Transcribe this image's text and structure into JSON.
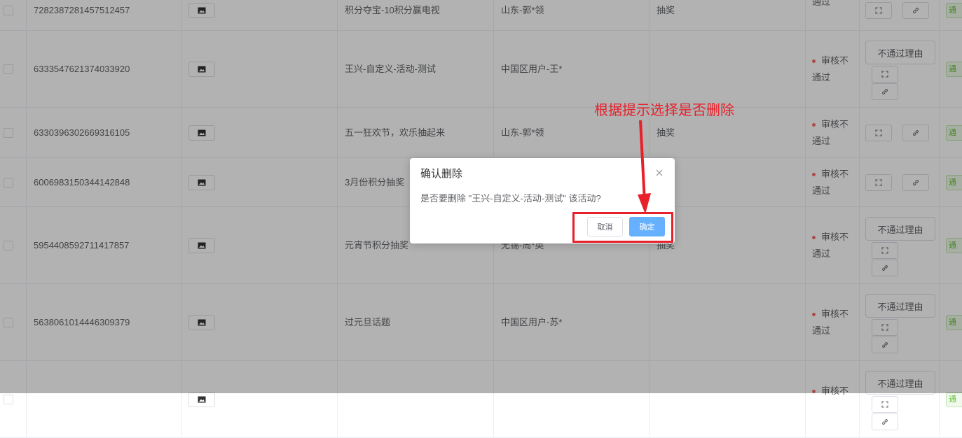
{
  "table": {
    "rows": [
      {
        "id": "7282387281457512457",
        "name": "积分夺宝-10积分赢电视",
        "creator": "山东-郭*领",
        "type": "抽奖",
        "status_line1": "",
        "status_line2": "通过",
        "has_reason": false
      },
      {
        "id": "6333547621374033920",
        "name": "王兴-自定义-活动-测试",
        "creator": "中国区用户-王*",
        "type": "",
        "status_line1": "审核不",
        "status_line2": "通过",
        "has_reason": true
      },
      {
        "id": "6330396302669316105",
        "name": "五一狂欢节，欢乐抽起来",
        "creator": "山东-郭*领",
        "type": "抽奖",
        "status_line1": "审核不",
        "status_line2": "通过",
        "has_reason": false
      },
      {
        "id": "6006983150344142848",
        "name": "3月份积分抽奖",
        "creator": "",
        "type": "",
        "status_line1": "审核不",
        "status_line2": "通过",
        "has_reason": false
      },
      {
        "id": "5954408592711417857",
        "name": "元宵节积分抽奖",
        "creator": "无锡-周*英",
        "type": "抽奖",
        "status_line1": "审核不",
        "status_line2": "通过",
        "has_reason": true
      },
      {
        "id": "5638061014446309379",
        "name": "过元旦话题",
        "creator": "中国区用户-苏*",
        "type": "",
        "status_line1": "审核不",
        "status_line2": "通过",
        "has_reason": true
      },
      {
        "id": "",
        "name": "",
        "creator": "",
        "type": "",
        "status_line1": "审核不",
        "status_line2": "",
        "has_reason": true
      }
    ],
    "reason_button_label": "不通过理由",
    "tag_label": "通"
  },
  "dialog": {
    "title": "确认删除",
    "message": "是否要删除 \"王兴-自定义-活动-测试\" 该活动?",
    "cancel_label": "取消",
    "confirm_label": "确定"
  },
  "annotation": {
    "text": "根据提示选择是否删除",
    "color": "#e8202a"
  },
  "colors": {
    "primary": "#66b1ff",
    "danger": "#f56c6c",
    "success": "#67c23a"
  }
}
